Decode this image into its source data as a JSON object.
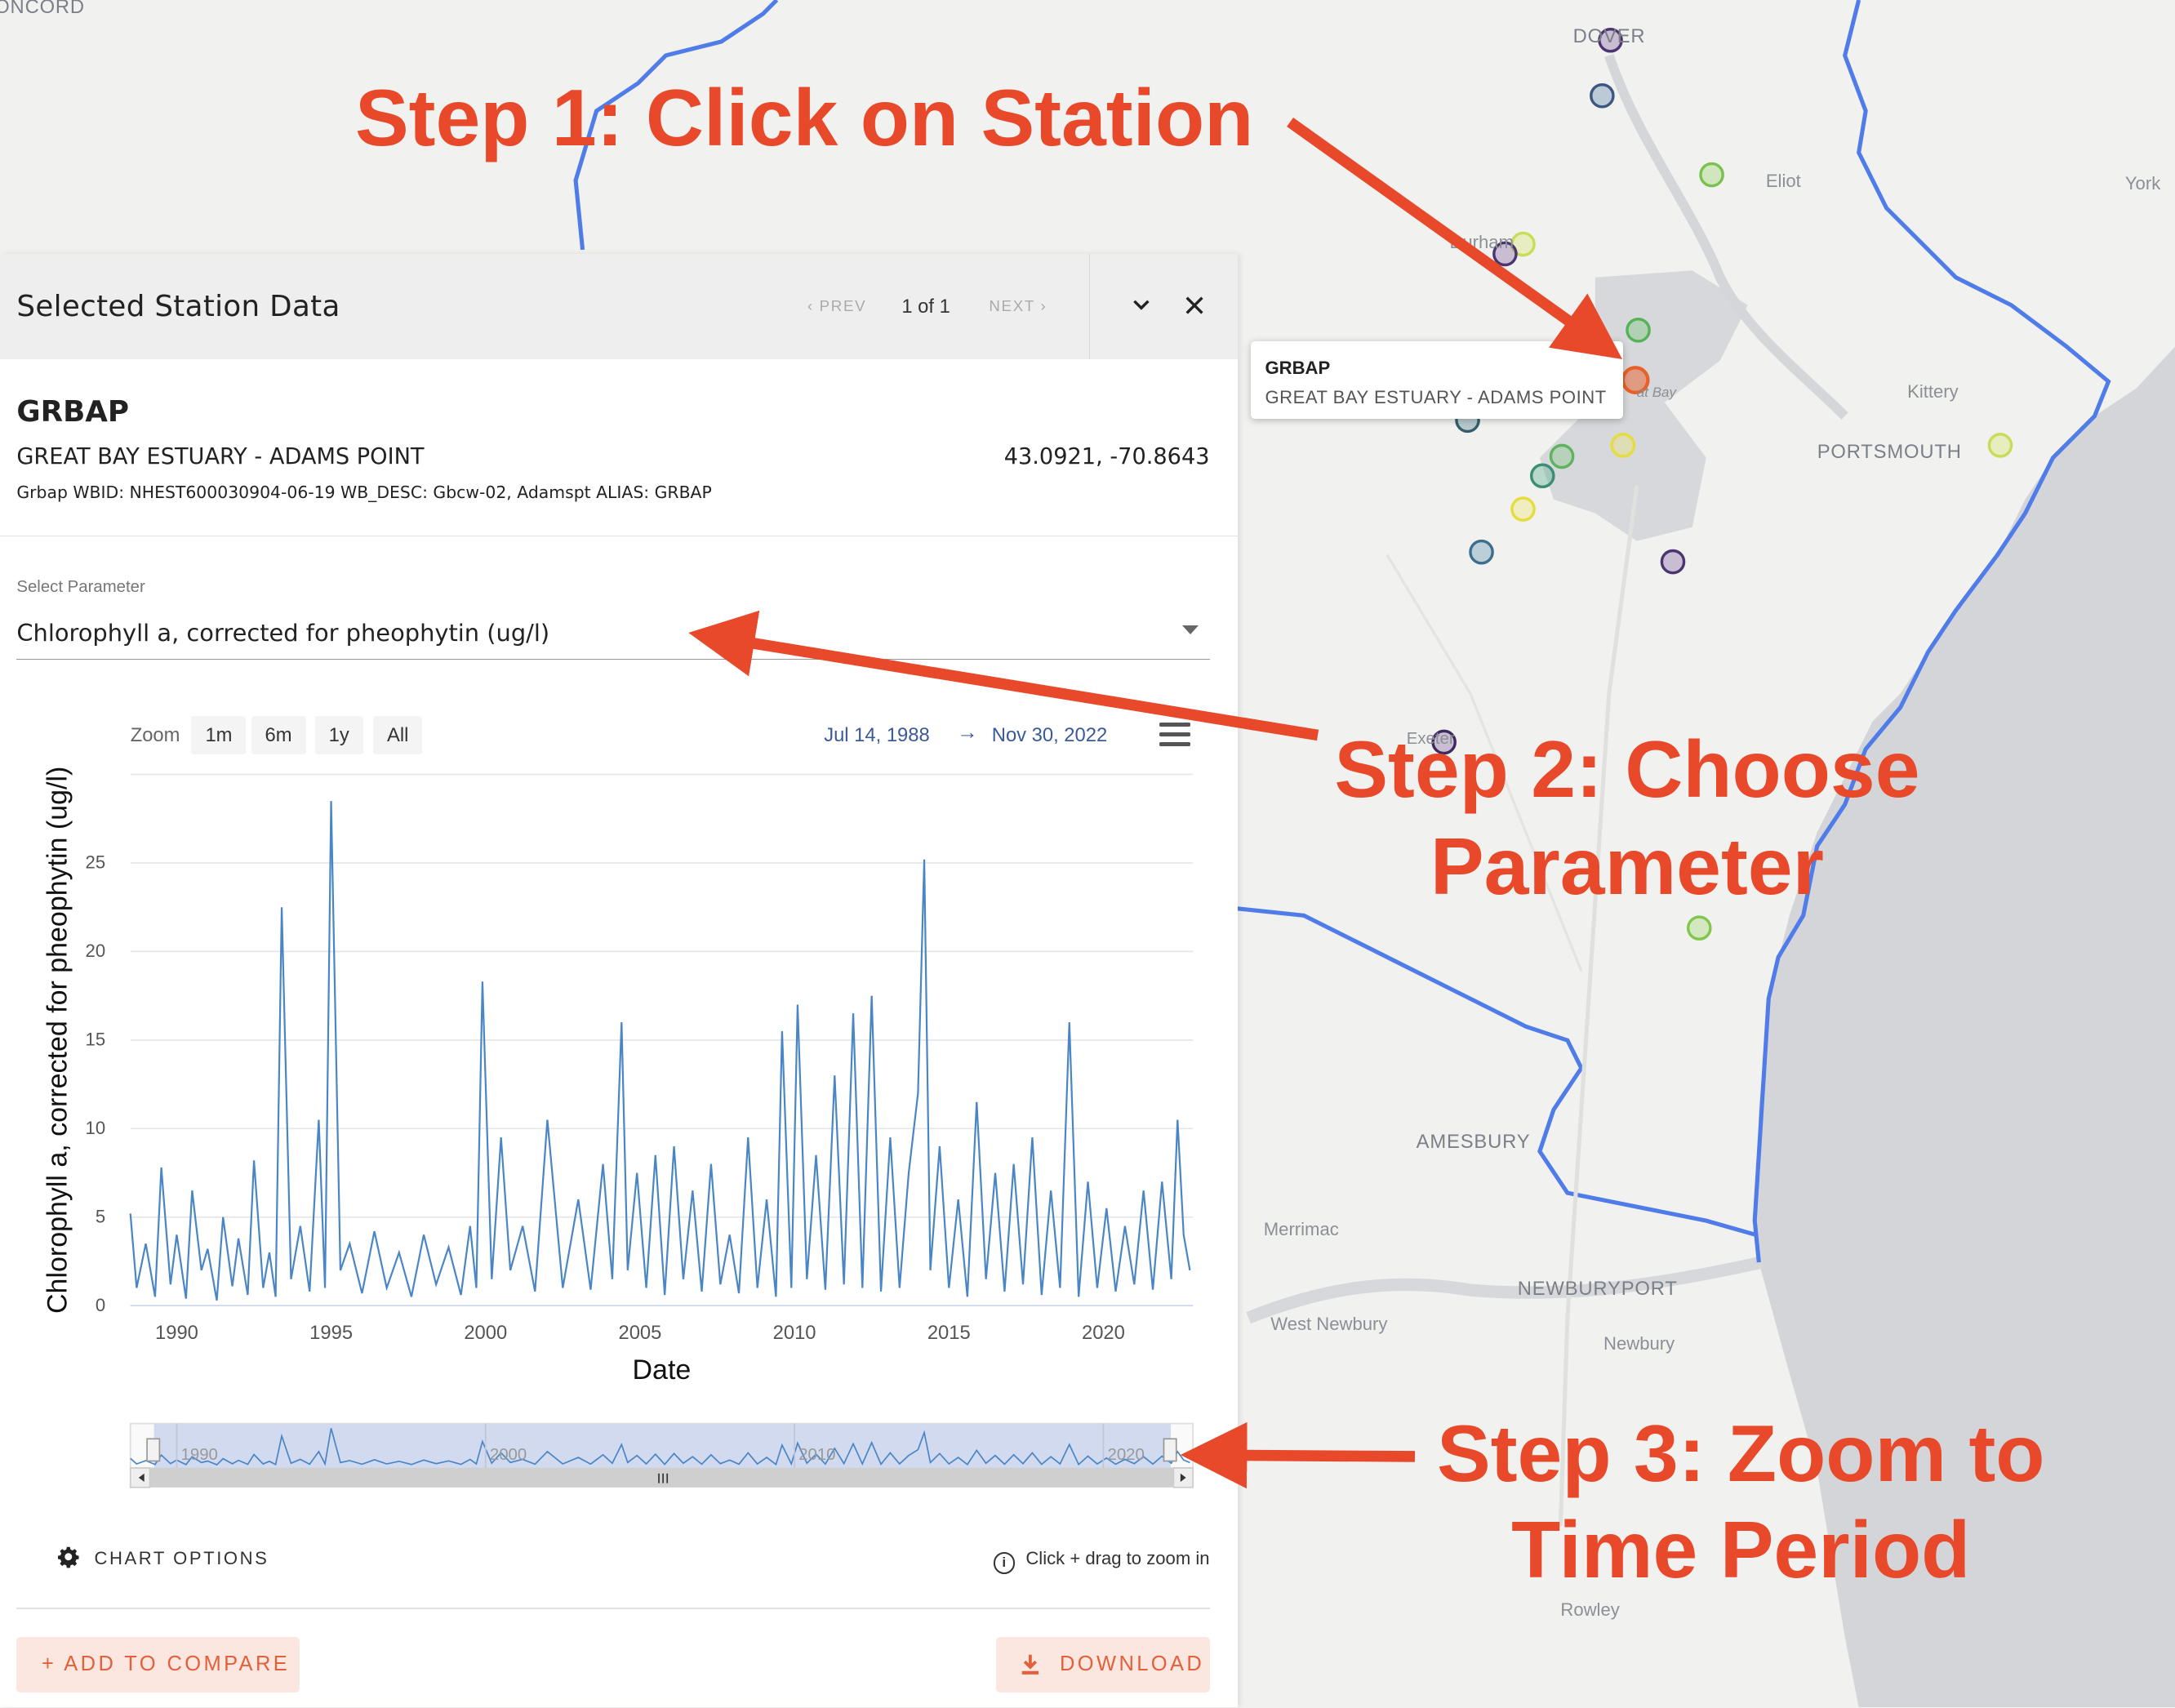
{
  "map": {
    "labels": {
      "concord": "ONCORD",
      "dover": "DOVER",
      "eliot": "Eliot",
      "york": "York",
      "durham": "Durham",
      "kittery": "Kittery",
      "portsmouth": "PORTSMOUTH",
      "great_bay": "at Bay",
      "exeter": "Exeter",
      "amesbury": "AMESBURY",
      "merrimac": "Merrimac",
      "west_newbury": "West Newbury",
      "newburyport": "NEWBURYPORT",
      "newbury": "Newbury",
      "rowley": "Rowley"
    },
    "colors": {
      "boundary": "#4f7ce8",
      "ocean": "#d3d5d8",
      "land": "#f1f1ef",
      "water": "#c9cbce"
    },
    "tooltip": {
      "code": "GRBAP",
      "name": "GREAT BAY ESTUARY - ADAMS POINT"
    }
  },
  "panel": {
    "title": "Selected Station Data",
    "prev": "‹ PREV",
    "next": "NEXT ›",
    "page": "1 of 1",
    "collapse_icon": "chevron-down-icon",
    "close_icon": "close-icon",
    "station": {
      "code": "GRBAP",
      "name": "GREAT BAY ESTUARY - ADAMS POINT",
      "coords": "43.0921, -70.8643",
      "meta": "Grbap WBID: NHEST600030904-06-19 WB_DESC: Gbcw-02, Adamspt ALIAS: GRBAP"
    },
    "parameter": {
      "label": "Select Parameter",
      "value": "Chlorophyll a, corrected for pheophytin (ug/l)"
    },
    "zoom": {
      "label": "Zoom",
      "buttons": [
        "1m",
        "6m",
        "1y",
        "All"
      ]
    },
    "range": {
      "from": "Jul 14, 1988",
      "arrow": "→",
      "to": "Nov 30, 2022"
    },
    "chart_options": "CHART OPTIONS",
    "hint": "Click + drag to zoom in",
    "add_compare": "+   ADD TO COMPARE",
    "download": "DOWNLOAD"
  },
  "annotations": {
    "step1": "Step 1: Click on Station",
    "step2_line1": "Step 2: Choose",
    "step2_line2": "Parameter",
    "step3_line1": "Step 3: Zoom to",
    "step3_line2": "Time Period",
    "color": "#e8492a"
  },
  "chart_data": {
    "type": "line",
    "xlabel": "Date",
    "ylabel": "Chlorophyll a, corrected for pheophytin (ug/l)",
    "xlim": [
      1988.5,
      2022.9
    ],
    "ylim": [
      0,
      30
    ],
    "xticks": [
      1990,
      1995,
      2000,
      2005,
      2010,
      2015,
      2020
    ],
    "yticks": [
      0,
      5,
      10,
      15,
      20,
      25
    ],
    "line_color": "#4a86c5",
    "series": [
      {
        "x": [
          1988.5,
          1988.7,
          1989.0,
          1989.3,
          1989.5,
          1989.8,
          1990.0,
          1990.3,
          1990.5,
          1990.8,
          1991.0,
          1991.3,
          1991.5,
          1991.8,
          1992.0,
          1992.3,
          1992.5,
          1992.8,
          1993.0,
          1993.2,
          1993.4,
          1993.7,
          1994.0,
          1994.3,
          1994.6,
          1994.8,
          1995.0,
          1995.3,
          1995.6,
          1996.0,
          1996.4,
          1996.8,
          1997.2,
          1997.6,
          1998.0,
          1998.4,
          1998.8,
          1999.2,
          1999.5,
          1999.7,
          1999.9,
          2000.2,
          2000.5,
          2000.8,
          2001.2,
          2001.6,
          2002.0,
          2002.5,
          2003.0,
          2003.4,
          2003.8,
          2004.1,
          2004.4,
          2004.6,
          2004.9,
          2005.2,
          2005.5,
          2005.8,
          2006.1,
          2006.4,
          2006.7,
          2007.0,
          2007.3,
          2007.6,
          2007.9,
          2008.2,
          2008.5,
          2008.8,
          2009.1,
          2009.4,
          2009.6,
          2009.9,
          2010.1,
          2010.4,
          2010.7,
          2011.0,
          2011.3,
          2011.6,
          2011.9,
          2012.2,
          2012.5,
          2012.8,
          2013.1,
          2013.4,
          2013.7,
          2014.0,
          2014.2,
          2014.4,
          2014.7,
          2015.0,
          2015.3,
          2015.6,
          2015.9,
          2016.2,
          2016.5,
          2016.8,
          2017.1,
          2017.4,
          2017.7,
          2018.0,
          2018.3,
          2018.6,
          2018.9,
          2019.2,
          2019.5,
          2019.8,
          2020.1,
          2020.4,
          2020.7,
          2021.0,
          2021.3,
          2021.6,
          2021.9,
          2022.2,
          2022.4,
          2022.6,
          2022.8
        ],
        "y": [
          5.2,
          1.0,
          3.5,
          0.5,
          7.8,
          1.2,
          4.0,
          0.4,
          6.5,
          2.0,
          3.2,
          0.3,
          5.0,
          1.1,
          3.8,
          0.6,
          8.2,
          1.0,
          3.0,
          0.5,
          22.5,
          1.5,
          4.5,
          0.8,
          10.5,
          1.0,
          28.5,
          2.0,
          3.5,
          0.7,
          4.2,
          1.0,
          3.0,
          0.5,
          4.0,
          1.2,
          3.3,
          0.6,
          4.5,
          1.0,
          18.3,
          1.5,
          9.5,
          2.0,
          4.5,
          0.8,
          10.5,
          1.0,
          6.0,
          0.9,
          8.0,
          1.5,
          16.0,
          2.0,
          7.5,
          1.0,
          8.5,
          0.6,
          9.0,
          1.5,
          6.5,
          0.8,
          8.0,
          1.2,
          4.0,
          0.7,
          9.5,
          1.0,
          6.0,
          0.5,
          15.5,
          1.0,
          17.0,
          1.5,
          8.5,
          0.9,
          13.0,
          1.2,
          16.5,
          1.0,
          17.5,
          0.8,
          9.5,
          1.0,
          7.5,
          12.0,
          25.2,
          2.0,
          9.0,
          1.0,
          6.0,
          0.5,
          11.5,
          1.5,
          7.5,
          0.8,
          8.0,
          1.2,
          9.5,
          0.6,
          6.5,
          1.0,
          16.0,
          0.5,
          7.0,
          1.0,
          5.5,
          0.8,
          4.5,
          1.2,
          6.5,
          0.9,
          7.0,
          1.5,
          10.5,
          4.0,
          2.0
        ]
      }
    ],
    "navigator": {
      "xticks": [
        "1990",
        "2000",
        "2010",
        "2020"
      ]
    }
  }
}
